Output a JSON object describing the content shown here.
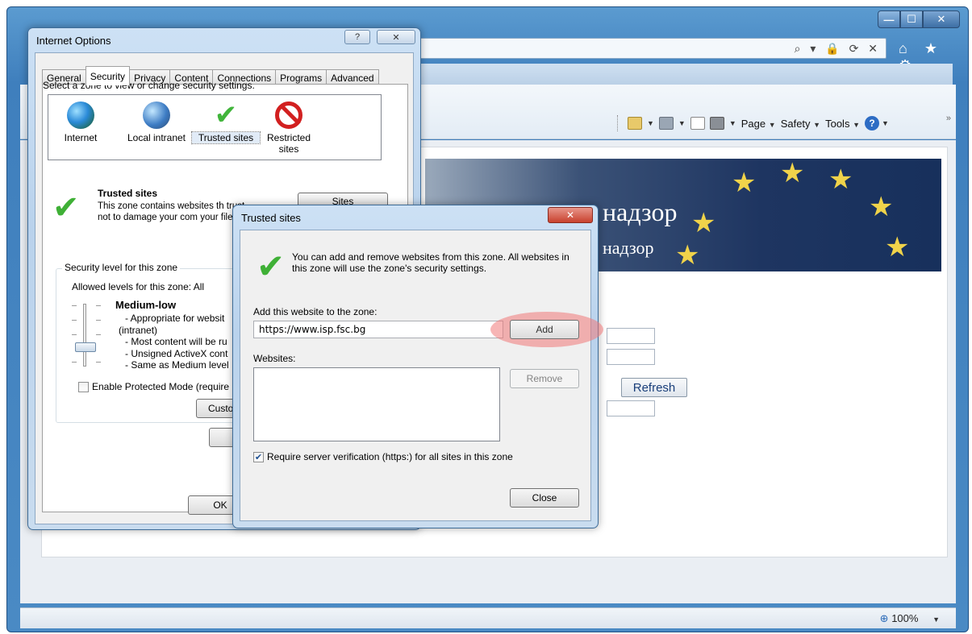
{
  "browser": {
    "window_buttons": {
      "minimize": "—",
      "maximize": "☐",
      "close": "✕"
    },
    "address_icons": "⌕ ▾ 🔒 ⟳ ✕",
    "nav_icons": {
      "home": "⌂",
      "favorites": "★",
      "tools": "⚙"
    },
    "command_bar": {
      "page_label": "Page",
      "safety_label": "Safety",
      "tools_label": "Tools",
      "help_label": "?",
      "overflow": "»"
    },
    "page": {
      "banner_title": "надзор",
      "banner_sub": "надзор",
      "refresh_label": "Refresh"
    },
    "status": {
      "zoom": "100%"
    }
  },
  "internet_options": {
    "title": "Internet Options",
    "help_button": "?",
    "close_button": "✕",
    "tabs": [
      {
        "label": "General"
      },
      {
        "label": "Security"
      },
      {
        "label": "Privacy"
      },
      {
        "label": "Content"
      },
      {
        "label": "Connections"
      },
      {
        "label": "Programs"
      },
      {
        "label": "Advanced"
      }
    ],
    "active_tab": "Security",
    "zone_prompt": "Select a zone to view or change security settings.",
    "zones": [
      {
        "label": "Internet",
        "icon": "globe-icon"
      },
      {
        "label": "Local intranet",
        "icon": "intranet-icon"
      },
      {
        "label": "Trusted sites",
        "icon": "checkmark-icon"
      },
      {
        "label": "Restricted sites",
        "icon": "restricted-icon"
      }
    ],
    "selected_zone": "Trusted sites",
    "zone_heading": "Trusted sites",
    "zone_desc": "This zone contains websites th trust not to damage your com your files.",
    "sites_button": "Sites",
    "security_level_group": "Security level for this zone",
    "allowed_levels": "Allowed levels for this zone: All",
    "level_name": "Medium-low",
    "level_desc": [
      "- Appropriate for websit",
      "(intranet)",
      "- Most content will be ru",
      "- Unsigned ActiveX cont",
      "- Same as Medium level"
    ],
    "protected_mode_label": "Enable Protected Mode (require",
    "protected_mode_checked": false,
    "custom_level_button": "Custo",
    "ok_button": "OK"
  },
  "trusted_sites": {
    "title": "Trusted sites",
    "close_button": "✕",
    "info_text": "You can add and remove websites from this zone. All websites in this zone will use the zone's security settings.",
    "add_label": "Add this website to the zone:",
    "url_value": "https://www.isp.fsc.bg",
    "add_button": "Add",
    "websites_label": "Websites:",
    "websites": [],
    "remove_button": "Remove",
    "require_verification_label": "Require server verification (https:) for all sites in this zone",
    "require_verification_checked": true,
    "close_label": "Close",
    "highlight_color": "#f07878"
  }
}
